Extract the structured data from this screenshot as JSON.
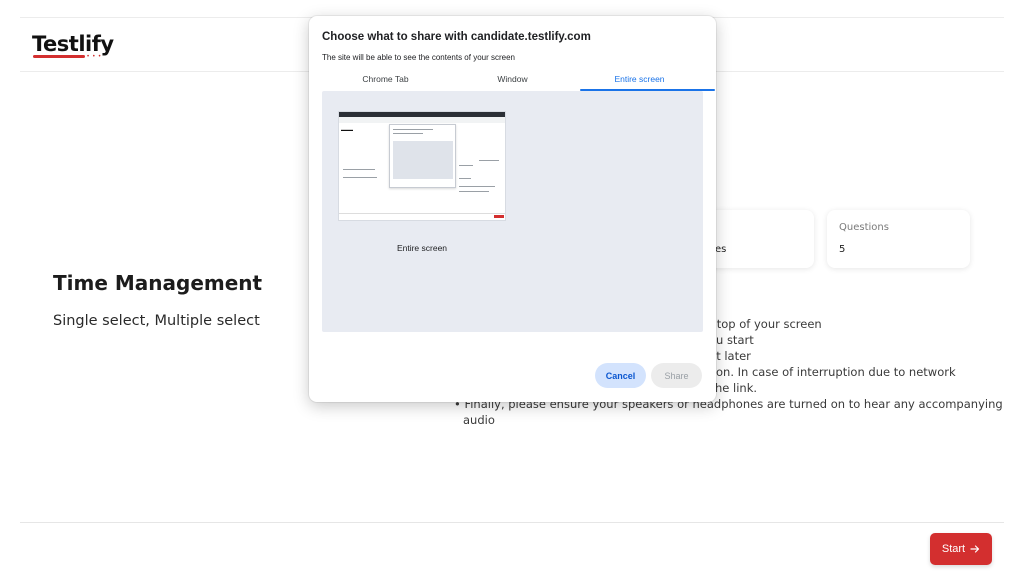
{
  "app": {
    "logo": "Testlify",
    "logo_dots": "• • •"
  },
  "section": {
    "title": "Time Management",
    "subtitle": "Single select, Multiple select"
  },
  "cards": [
    {
      "label": "",
      "value": "es"
    },
    {
      "label": "Questions",
      "value": "5"
    }
  ],
  "instructions": [
    "e top of your screen",
    "u start",
    "it later",
    "on. In case of interruption due to network",
    "he link.",
    "• Finally, please ensure your speakers or headphones are turned on to hear any accompanying",
    "audio"
  ],
  "footer": {
    "start_label": "Start",
    "start_icon": "arrow-right-icon"
  },
  "share_dialog": {
    "title": "Choose what to share with candidate.testlify.com",
    "subtitle": "The site will be able to see the contents of your screen",
    "tabs": [
      "Chrome Tab",
      "Window",
      "Entire screen"
    ],
    "active_tab": "Entire screen",
    "preview_label": "Entire screen",
    "cancel_label": "Cancel",
    "share_label": "Share"
  },
  "colors": {
    "brand_red": "#d32f2f",
    "accent_blue": "#1a73e8",
    "preview_bg": "#e8ebf2",
    "cancel_bg": "#d3e3fd"
  }
}
